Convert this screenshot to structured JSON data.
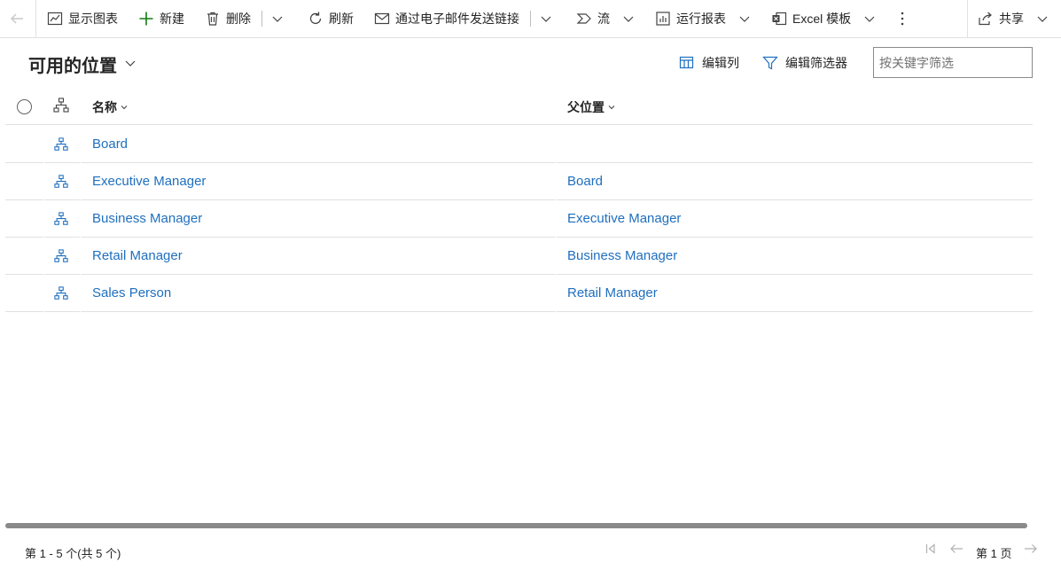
{
  "toolbar": {
    "back_icon": "back-arrow-icon",
    "show_chart": "显示图表",
    "new": "新建",
    "delete": "删除",
    "refresh": "刷新",
    "email_link": "通过电子邮件发送链接",
    "flow": "流",
    "run_report": "运行报表",
    "excel_template": "Excel 模板",
    "share": "共享"
  },
  "view": {
    "title": "可用的位置",
    "edit_columns": "编辑列",
    "edit_filters": "编辑筛选器",
    "search_placeholder": "按关键字筛选"
  },
  "grid": {
    "columns": [
      {
        "label": "名称"
      },
      {
        "label": "父位置"
      }
    ],
    "rows": [
      {
        "name": "Board",
        "parent": ""
      },
      {
        "name": "Executive Manager",
        "parent": "Board"
      },
      {
        "name": "Business Manager",
        "parent": "Executive Manager"
      },
      {
        "name": "Retail Manager",
        "parent": "Business Manager"
      },
      {
        "name": "Sales Person",
        "parent": "Retail Manager"
      }
    ]
  },
  "footer": {
    "record_count": "第 1 - 5 个(共 5 个)",
    "page_label": "第 1 页"
  },
  "colors": {
    "link": "#1f6fbf",
    "accent_green": "#107c10",
    "border": "#e1e1e1"
  }
}
